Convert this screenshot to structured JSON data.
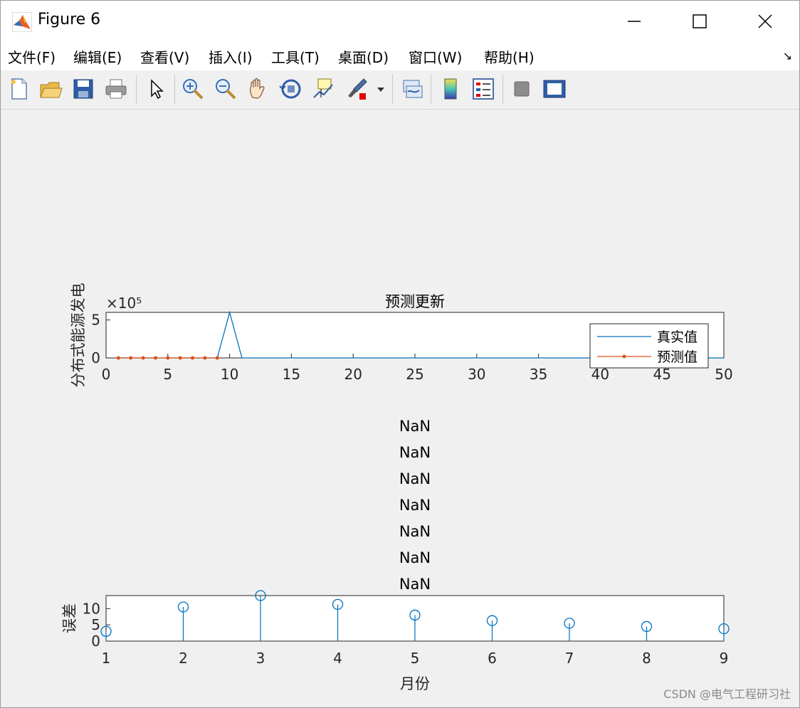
{
  "window": {
    "title": "Figure 6",
    "controls": [
      "minimize",
      "maximize",
      "close"
    ]
  },
  "menu": {
    "items": [
      "文件(F)",
      "编辑(E)",
      "查看(V)",
      "插入(I)",
      "工具(T)",
      "桌面(D)",
      "窗口(W)",
      "帮助(H)"
    ]
  },
  "toolbar": {
    "icons": [
      "new-figure-icon",
      "open-file-icon",
      "save-icon",
      "print-icon",
      "pointer-icon",
      "zoom-in-icon",
      "zoom-out-icon",
      "pan-hand-icon",
      "rotate-3d-icon",
      "data-cursor-icon",
      "brush-icon",
      "link-plot-icon",
      "colorbar-icon",
      "legend-icon",
      "hide-plot-tools-icon",
      "show-plot-tools-icon"
    ]
  },
  "colors": {
    "series1": "#0072BD",
    "series2": "#D95319"
  },
  "chart_data": [
    {
      "type": "line",
      "title": "预测更新",
      "ylabel": "分布式能源发电",
      "xlabel": "",
      "y_exponent": "×10⁵",
      "xlim": [
        0,
        50
      ],
      "ylim": [
        0,
        6
      ],
      "xticks": [
        0,
        5,
        10,
        15,
        20,
        25,
        30,
        35,
        40,
        45,
        50
      ],
      "yticks": [
        0,
        5
      ],
      "legend_position": "right",
      "grid": false,
      "series": [
        {
          "name": "真实值",
          "x": [
            1,
            2,
            3,
            4,
            5,
            6,
            7,
            8,
            9,
            10,
            11,
            12,
            13,
            14,
            15,
            16,
            17,
            18,
            19,
            20,
            21,
            22,
            23,
            24,
            25,
            26,
            27,
            28,
            29,
            30,
            31,
            32,
            33,
            34,
            35,
            36,
            37,
            38,
            39,
            40,
            41,
            42,
            43,
            44,
            45,
            46,
            47,
            48,
            49,
            50
          ],
          "y": [
            0,
            0,
            0,
            0,
            0,
            0,
            0,
            0,
            0,
            6,
            0,
            0,
            0,
            0,
            0,
            0,
            0,
            0,
            0,
            0,
            0,
            0,
            0,
            0,
            0,
            0,
            0,
            0,
            0,
            0,
            0,
            0,
            0,
            0,
            0,
            0,
            0,
            0,
            0,
            0,
            0,
            0,
            0,
            0,
            0,
            0,
            0,
            0,
            0,
            0
          ]
        },
        {
          "name": "预测值",
          "x": [
            1,
            2,
            3,
            4,
            5,
            6,
            7,
            8,
            9
          ],
          "y": [
            0,
            0,
            0,
            0,
            0,
            0,
            0,
            0,
            0
          ]
        }
      ]
    },
    {
      "type": "stem",
      "title_lines": [
        "NaN",
        "NaN",
        "NaN",
        "NaN",
        "NaN",
        "NaN",
        "NaN"
      ],
      "xlabel": "月份",
      "ylabel": "误差",
      "xlim": [
        1,
        9
      ],
      "ylim": [
        0,
        14
      ],
      "xticks": [
        1,
        2,
        3,
        4,
        5,
        6,
        7,
        8,
        9
      ],
      "yticks": [
        0,
        5,
        10
      ],
      "series": [
        {
          "x": [
            1,
            2,
            3,
            4,
            5,
            6,
            7,
            8,
            9
          ],
          "y": [
            3,
            10.5,
            14,
            11.3,
            8,
            6.3,
            5.5,
            4.5,
            3.8
          ]
        }
      ]
    }
  ],
  "watermark": "CSDN @电气工程研习社"
}
